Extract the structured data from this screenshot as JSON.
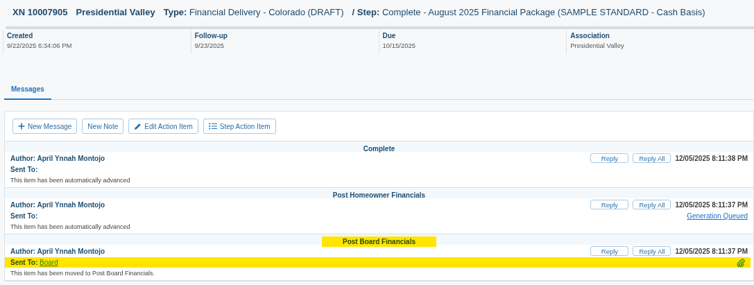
{
  "header": {
    "number": "XN 10007905",
    "association": "Presidential Valley",
    "type": "**Type:** Financial Delivery - Colorado (DRAFT)",
    "step": "**/ Step:** Complete - August 2025 Financial Package (SAMPLE STANDARD - Cash Basis)"
  },
  "info": [
    {
      "label": "Created",
      "value": "9/22/2025 6:34:06 PM"
    },
    {
      "label": "Follow-up",
      "value": "9/23/2025"
    },
    {
      "label": "Due",
      "value": "10/15/2025"
    },
    {
      "label": "Association",
      "value": "Presidential Valley"
    }
  ],
  "tabs": [
    {
      "label": "Messages",
      "selected": true
    }
  ],
  "toolbar": [
    {
      "label": "New Message",
      "kind": "plus"
    },
    {
      "label": "New Note",
      "kind": "plain"
    },
    {
      "label": "Edit Action Item",
      "kind": "pencil"
    },
    {
      "label": "Step Action Item",
      "kind": "list"
    }
  ],
  "messages": [
    {
      "heading": "Complete",
      "author": "Author: April Ynnah Montojo",
      "sent_to_label": "Sent To:",
      "reply": "Reply",
      "reply_all": "Reply All",
      "date": "12/05/2025 8:11:38 PM",
      "body": "This item has been automatically advanced",
      "highlighted": false,
      "attachment": false
    },
    {
      "heading": "Post Homeowner Financials",
      "author": "Author: April Ynnah Montojo",
      "sent_to_label": "Sent To:",
      "reply": "Reply",
      "reply_all": "Reply All",
      "date": "12/05/2025 8:11:37 PM",
      "status_link": "Generation Queued",
      "body": "This item has been automatically advanced",
      "highlighted": false,
      "attachment": false
    },
    {
      "heading": "Post Board Financials",
      "author": "Author: April Ynnah Montojo",
      "sent_to_label": "Sent To:",
      "sent_to_link": "Board",
      "reply": "Reply",
      "reply_all": "Reply All",
      "date": "12/05/2025 8:11:37 PM",
      "body": "This item has been moved to Post Board Financials.",
      "highlighted": true,
      "attachment": true
    }
  ]
}
